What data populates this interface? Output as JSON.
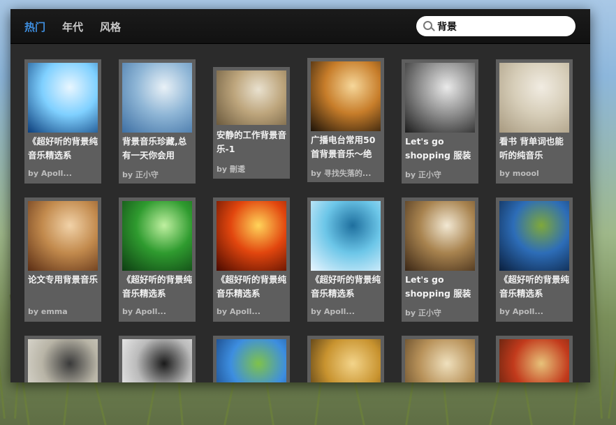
{
  "tabs": [
    {
      "label": "热门",
      "active": true
    },
    {
      "label": "年代",
      "active": false
    },
    {
      "label": "风格",
      "active": false
    }
  ],
  "search": {
    "value": "背景",
    "icon": "search-icon"
  },
  "playlists": [
    {
      "title": "《超好听的背景纯音乐精选系",
      "author": "by Apoll...",
      "thumb": "winter-piano-stairs",
      "colors": [
        "#0b3d7a",
        "#7fd0ff",
        "#e8f6ff"
      ]
    },
    {
      "title": "背景音乐珍藏,总有一天你会用",
      "author": "by 正小守",
      "thumb": "snowflakes",
      "colors": [
        "#3d6fa3",
        "#8fb6d6",
        "#e9f1f7"
      ]
    },
    {
      "title": "安静的工作背景音乐-1",
      "author": "by 刪逶",
      "thumb": "hand-on-blocks",
      "colors": [
        "#6b5a3e",
        "#bda57c",
        "#e9e1cf"
      ]
    },
    {
      "title": "广播电台常用50首背景音乐～绝",
      "author": "by 寻找失落的...",
      "thumb": "sunset-cliff",
      "colors": [
        "#1c1208",
        "#c77d2a",
        "#f6d79a"
      ]
    },
    {
      "title": "Let's go shopping 服装",
      "author": "by 正小守",
      "thumb": "shop-front",
      "colors": [
        "#1b1b1b",
        "#8f8f8f",
        "#eaeaea"
      ]
    },
    {
      "title": "看书 背单词也能听的纯音乐",
      "author": "by moool",
      "thumb": "reading-girl",
      "colors": [
        "#a89a80",
        "#d6cdb8",
        "#f1ece2"
      ]
    },
    {
      "title": "论文专用背景音乐",
      "author": "by emma",
      "thumb": "arcade-hall",
      "colors": [
        "#5a2d14",
        "#c28a4d",
        "#f1d2a8"
      ]
    },
    {
      "title": "《超好听的背景纯音乐精选系",
      "author": "by Apoll...",
      "thumb": "bamboo-forest",
      "colors": [
        "#0d3d12",
        "#2f9b2f",
        "#bff0a0"
      ]
    },
    {
      "title": "《超好听的背景纯音乐精选系",
      "author": "by Apoll...",
      "thumb": "fire-phoenix",
      "colors": [
        "#4a0a00",
        "#e2460e",
        "#ffd45a"
      ]
    },
    {
      "title": "《超好听的背景纯音乐精选系",
      "author": "by Apoll...",
      "thumb": "anime-girl",
      "colors": [
        "#eaf6ff",
        "#6cc6e8",
        "#1e6f9e"
      ]
    },
    {
      "title": "Let's go shopping 服装",
      "author": "by 正小守",
      "thumb": "street-cafe",
      "colors": [
        "#3a2615",
        "#a8834f",
        "#f2e8d3"
      ]
    },
    {
      "title": "《超好听的背景纯音乐精选系",
      "author": "by Apoll...",
      "thumb": "storm-field",
      "colors": [
        "#0a1f3d",
        "#2d6db8",
        "#7fa83a"
      ]
    },
    {
      "title": "",
      "author": "",
      "thumb": "rider-silhouette",
      "colors": [
        "#e8e6df",
        "#b8b4a6",
        "#3a3a3a"
      ]
    },
    {
      "title": "",
      "author": "",
      "thumb": "portrait",
      "colors": [
        "#ffffff",
        "#bbbbbb",
        "#1a1a1a"
      ]
    },
    {
      "title": "",
      "author": "",
      "thumb": "moon-leaves",
      "colors": [
        "#0e2f66",
        "#3d8ee0",
        "#7fc24a"
      ]
    },
    {
      "title": "",
      "author": "",
      "thumb": "fantasy-warrior",
      "colors": [
        "#2b1d0e",
        "#c8932f",
        "#f3d48a"
      ]
    },
    {
      "title": "",
      "author": "",
      "thumb": "sheet-music",
      "colors": [
        "#4a341a",
        "#b8925a",
        "#efe0bd"
      ]
    },
    {
      "title": "",
      "author": "",
      "thumb": "collage",
      "colors": [
        "#3b1a0a",
        "#c23a1c",
        "#e7c27a"
      ]
    }
  ]
}
